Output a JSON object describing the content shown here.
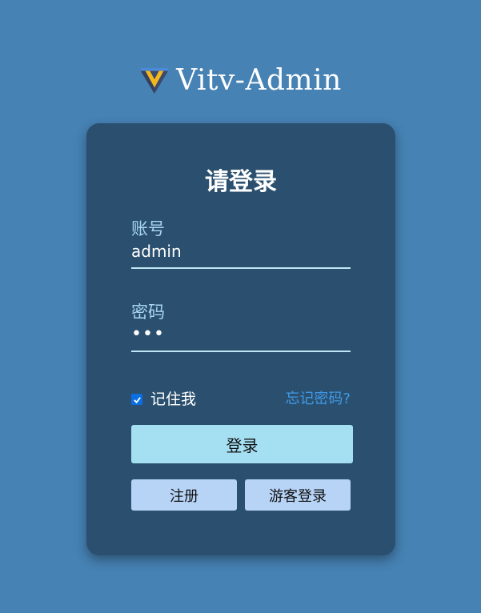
{
  "brand": {
    "title": "Vitv-Admin",
    "logo_icon": "vue-logo-icon"
  },
  "login_form": {
    "title": "请登录",
    "username": {
      "label": "账号",
      "value": "admin"
    },
    "password": {
      "label": "密码",
      "value": "•••"
    },
    "remember_me": {
      "label": "记住我",
      "checked": true
    },
    "forgot_password_label": "忘记密码?",
    "login_button_label": "登录",
    "register_button_label": "注册",
    "guest_login_button_label": "游客登录"
  },
  "colors": {
    "page_background": "#4682b4",
    "card_background": "#2b506f",
    "label_color": "#a9d6f0",
    "link_color": "#3f99e6",
    "login_button": "#a5e0f2",
    "secondary_button": "#b7d4f7",
    "checkbox_accent": "#0b6fe3"
  }
}
